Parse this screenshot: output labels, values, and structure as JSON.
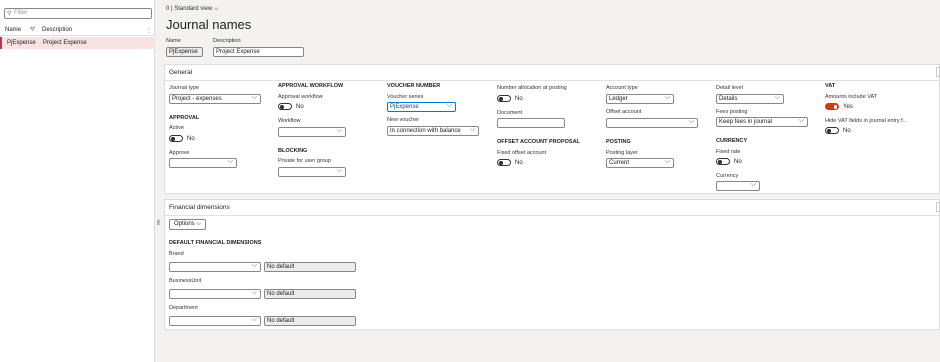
{
  "left": {
    "filter_placeholder": "Filter",
    "col_name": "Name",
    "col_desc": "Description",
    "row_name": "PjExpense",
    "row_desc": "Project Expense"
  },
  "topbar": {
    "zero": "0",
    "view": "Standard view"
  },
  "title": "Journal names",
  "header": {
    "name_label": "Name",
    "name_value": "PjExpense",
    "desc_label": "Description",
    "desc_value": "Project Expense"
  },
  "general": {
    "heading": "General",
    "journal_type_label": "Journal type",
    "journal_type_value": "Project - expenses",
    "approval_heading": "APPROVAL",
    "active_label": "Active",
    "active_value": "No",
    "approve_label": "Approve",
    "approval_workflow_heading": "APPROVAL WORKFLOW",
    "approval_workflow_label": "Approval workflow",
    "approval_workflow_value": "No",
    "workflow_label": "Workflow",
    "blocking_heading": "BLOCKING",
    "private_label": "Private for user group",
    "voucher_heading": "VOUCHER NUMBER",
    "voucher_series_label": "Voucher series",
    "voucher_series_value": "PjExpense",
    "new_voucher_label": "New voucher",
    "new_voucher_value": "In connection with balance",
    "num_alloc_label": "Number allocation at posting",
    "num_alloc_value": "No",
    "document_label": "Document",
    "offset_heading": "OFFSET ACCOUNT PROPOSAL",
    "fixed_offset_label": "Fixed offset account",
    "fixed_offset_value": "No",
    "account_type_label": "Account type",
    "account_type_value": "Ledger",
    "offset_account_label": "Offset account",
    "posting_heading": "POSTING",
    "posting_layer_label": "Posting layer",
    "posting_layer_value": "Current",
    "detail_level_label": "Detail level",
    "detail_level_value": "Details",
    "fees_posting_label": "Fees posting",
    "fees_posting_value": "Keep fees in journal",
    "currency_heading": "CURRENCY",
    "fixed_rate_label": "Fixed rate",
    "fixed_rate_value": "No",
    "currency_label": "Currency",
    "vat_heading": "VAT",
    "amounts_vat_label": "Amounts include VAT",
    "amounts_vat_value": "Yes",
    "hide_vat_label": "Hide VAT fields in journal entry f...",
    "hide_vat_value": "No"
  },
  "fin": {
    "heading": "Financial dimensions",
    "options_label": "Options",
    "default_heading": "DEFAULT FINANCIAL DIMENSIONS",
    "dims": [
      {
        "label": "Brand",
        "default": "No default"
      },
      {
        "label": "BusinessUnit",
        "default": "No default"
      },
      {
        "label": "Department",
        "default": "No default"
      }
    ]
  },
  "colors": {
    "accent": "#0078d4",
    "toggle_on": "#c43e1c",
    "selected_row": "#f6e3e2"
  }
}
